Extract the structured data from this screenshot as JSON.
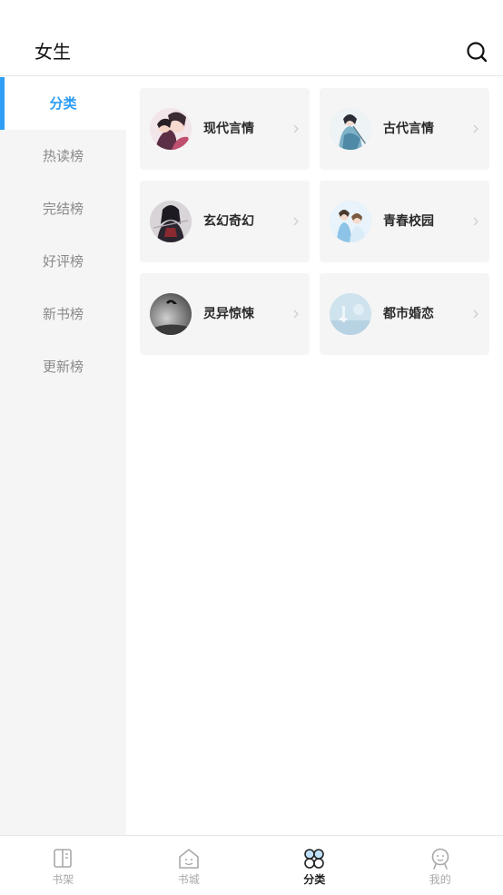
{
  "header": {
    "title": "女生",
    "search_icon": "search-icon"
  },
  "sidebar": {
    "items": [
      {
        "label": "分类",
        "active": true
      },
      {
        "label": "热读榜",
        "active": false
      },
      {
        "label": "完结榜",
        "active": false
      },
      {
        "label": "好评榜",
        "active": false
      },
      {
        "label": "新书榜",
        "active": false
      },
      {
        "label": "更新榜",
        "active": false
      }
    ]
  },
  "categories": [
    {
      "label": "现代言情",
      "icon": "modern-romance-avatar"
    },
    {
      "label": "古代言情",
      "icon": "ancient-romance-avatar"
    },
    {
      "label": "玄幻奇幻",
      "icon": "fantasy-avatar"
    },
    {
      "label": "青春校园",
      "icon": "campus-avatar"
    },
    {
      "label": "灵异惊悚",
      "icon": "horror-avatar"
    },
    {
      "label": "都市婚恋",
      "icon": "urban-marriage-avatar"
    }
  ],
  "tabbar": {
    "items": [
      {
        "label": "书架",
        "icon": "bookshelf-icon",
        "active": false
      },
      {
        "label": "书城",
        "icon": "bookstore-icon",
        "active": false
      },
      {
        "label": "分类",
        "icon": "category-icon",
        "active": true
      },
      {
        "label": "我的",
        "icon": "profile-icon",
        "active": false
      }
    ]
  },
  "colors": {
    "accent": "#2f9ef5",
    "sidebar_bg": "#f5f5f5",
    "card_bg": "#f5f5f5"
  }
}
